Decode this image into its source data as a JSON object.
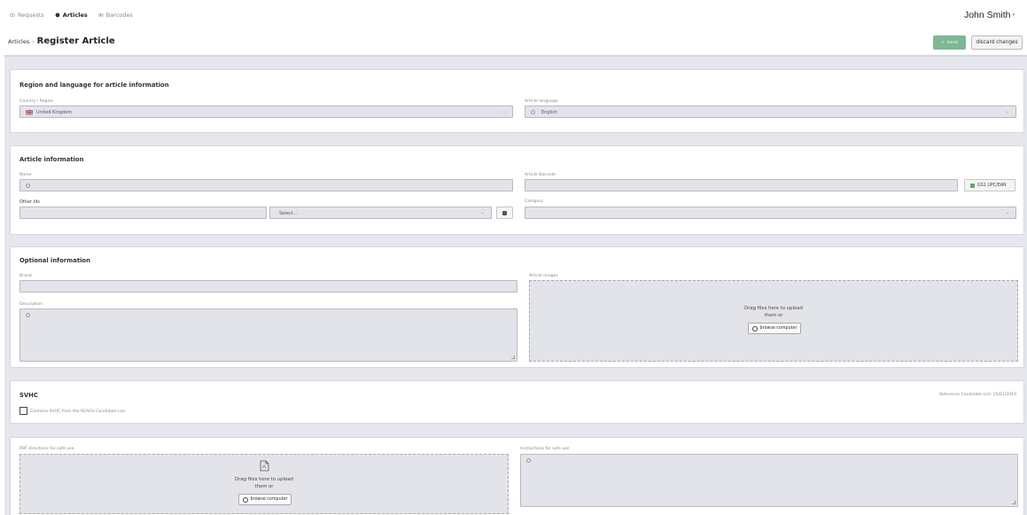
{
  "nav": {
    "items": [
      {
        "label": "Requests",
        "icon": "eye-icon"
      },
      {
        "label": "Articles",
        "icon": "tag-icon"
      },
      {
        "label": "Barcodes",
        "icon": "barcode-icon"
      }
    ],
    "user_name": "John Smith"
  },
  "header": {
    "breadcrumb_parent": "Articles",
    "breadcrumb_sep": "›",
    "title": "Register Article",
    "save_label": "save",
    "discard_label": "discard changes"
  },
  "region": {
    "title": "Region and language for article information",
    "country_label": "Country / Region",
    "country_value": "United Kingdom",
    "language_label": "Article language",
    "language_value": "English"
  },
  "article": {
    "title": "Article information",
    "name_label": "Name",
    "barcode_label": "Article Barcode",
    "gs1_label": "GS1 UPC/EAN",
    "other_ids_label": "Other Ids",
    "other_ids_select": "Select...",
    "category_label": "Category"
  },
  "optional": {
    "title": "Optional information",
    "brand_label": "Brand",
    "description_label": "Description",
    "images_label": "Article images",
    "drop_text_1": "Drag files here to upload",
    "drop_text_2": "them or",
    "browse_label": "browse computer"
  },
  "svhc": {
    "title": "SVHC",
    "reference": "Reference Candidate List: 15/01/2019",
    "checkbox_label": "Contains SVHC from the REACH Candidate List"
  },
  "safe_use": {
    "pdf_label": "PDF directions for safe use",
    "drop_text_1": "Drag files here to upload",
    "drop_text_2": "them or",
    "browse_label": "browse computer",
    "instructions_label": "Instructions for safe use"
  },
  "colors": {
    "accent_green": "#7fb892",
    "checkbox_green": "#5ba872",
    "content_bg": "#e6e7ec"
  }
}
